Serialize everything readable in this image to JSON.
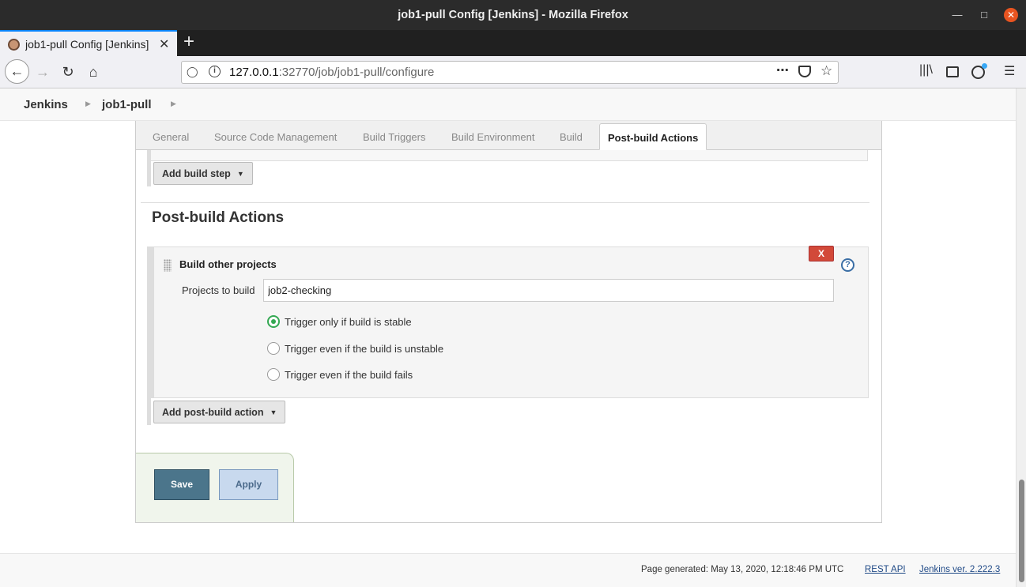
{
  "window": {
    "title": "job1-pull Config [Jenkins] - Mozilla Firefox"
  },
  "browser": {
    "tab_title": "job1-pull Config [Jenkins]",
    "url_host": "127.0.0.1",
    "url_rest": ":32770/job/job1-pull/configure"
  },
  "breadcrumb": {
    "items": [
      "Jenkins",
      "job1-pull"
    ]
  },
  "config_tabs": [
    "General",
    "Source Code Management",
    "Build Triggers",
    "Build Environment",
    "Build",
    "Post-build Actions"
  ],
  "build": {
    "add_step_label": "Add build step"
  },
  "post_build": {
    "section_title": "Post-build Actions",
    "action_title": "Build other projects",
    "delete_label": "X",
    "help_label": "?",
    "projects_label": "Projects to build",
    "projects_value": "job2-checking",
    "options": [
      {
        "label": "Trigger only if build is stable",
        "checked": true
      },
      {
        "label": "Trigger even if the build is unstable",
        "checked": false
      },
      {
        "label": "Trigger even if the build fails",
        "checked": false
      }
    ],
    "add_action_label": "Add post-build action"
  },
  "buttons": {
    "save": "Save",
    "apply": "Apply"
  },
  "footer": {
    "generated": "Page generated: May 13, 2020, 12:18:46 PM UTC",
    "rest_api": "REST API",
    "version": "Jenkins ver. 2.222.3"
  },
  "colors": {
    "save": "#4b758b",
    "apply": "#c8d9ee",
    "delete": "#d24939",
    "radio_checked": "#34a853"
  }
}
